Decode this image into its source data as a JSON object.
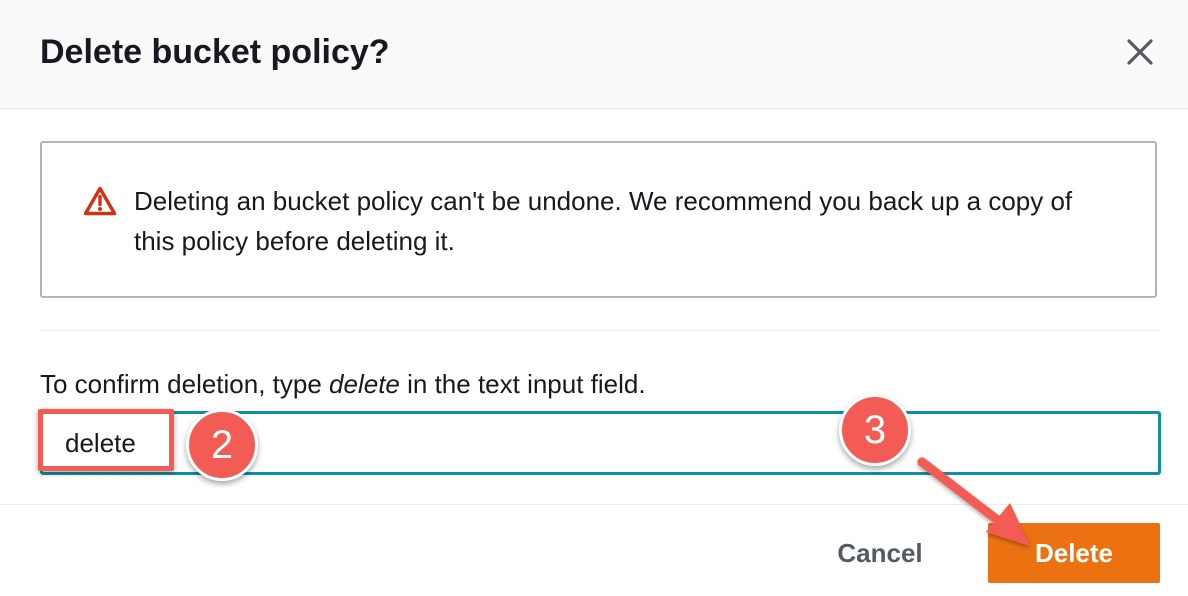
{
  "dialog": {
    "title": "Delete bucket policy?",
    "close_icon": "close-icon"
  },
  "alert": {
    "icon": "warning-icon",
    "message": "Deleting an bucket policy can't be undone. We recommend you back up a copy of this policy before deleting it."
  },
  "confirm": {
    "label_before": "To confirm deletion, type ",
    "label_keyword": "delete",
    "label_after": " in the text input field.",
    "input_value": "delete"
  },
  "annotations": {
    "step_input": "2",
    "step_delete": "3"
  },
  "footer": {
    "cancel_label": "Cancel",
    "delete_label": "Delete"
  },
  "colors": {
    "primary_button": "#ec7211",
    "input_focus_border": "#0f8fa8",
    "warning": "#d13212",
    "annotation": "#f25c54"
  }
}
